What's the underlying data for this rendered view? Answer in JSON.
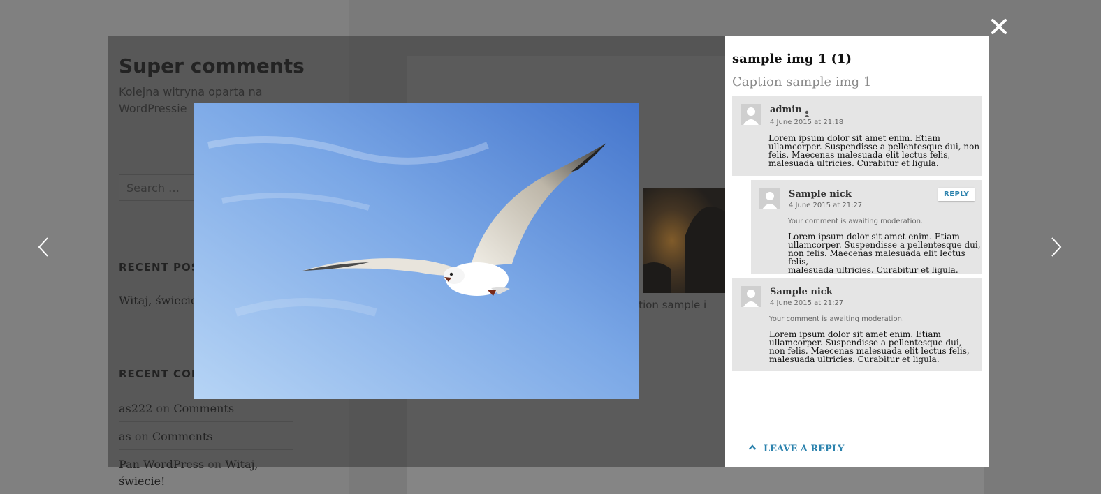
{
  "background_page": {
    "site_title": "Super comments",
    "tagline": "Kolejna witryna oparta na WordPressie",
    "search_placeholder": "Search …",
    "recent_posts_heading": "RECENT POSTS",
    "recent_posts": [
      "Witaj, świecie!"
    ],
    "recent_comments_heading": "RECENT COMMENTS",
    "recent_comments": [
      {
        "author": "as222",
        "on": "on",
        "post": "Comments"
      },
      {
        "author": "as",
        "on": "on",
        "post": "Comments"
      },
      {
        "author": "Pan WordPress",
        "on": "on",
        "post": "Witaj, świecie!"
      }
    ],
    "partial_caption": "Caption sample i"
  },
  "lightbox": {
    "close_icon": "close-icon",
    "prev_icon": "chevron-left-icon",
    "next_icon": "chevron-right-icon",
    "image_subject": "seagull in flight against blue sky"
  },
  "panel": {
    "title": "sample img 1 (1)",
    "caption": "Caption sample img 1",
    "comments": [
      {
        "author": "admin",
        "author_icon": "user-icon",
        "date": "4 June 2015 at 21:18",
        "text_lines": [
          "Lorem ipsum dolor sit amet enim. Etiam",
          "ullamcorper. Suspendisse a pellentesque dui, non",
          "felis. Maecenas malesuada elit lectus felis,",
          "malesuada ultricies. Curabitur et ligula."
        ]
      },
      {
        "author": "Sample nick",
        "date": "4 June 2015 at 21:27",
        "reply_label": "REPLY",
        "moderation": "Your comment is awaiting moderation.",
        "text_lines": [
          "Lorem ipsum dolor sit amet enim. Etiam",
          "ullamcorper. Suspendisse a pellentesque dui,",
          "non felis. Maecenas malesuada elit lectus felis,",
          "malesuada ultricies. Curabitur et ligula."
        ]
      },
      {
        "author": "Sample nick",
        "date": "4 June 2015 at 21:27",
        "moderation": "Your comment is awaiting moderation.",
        "text_lines": [
          "Lorem ipsum dolor sit amet enim. Etiam",
          "ullamcorper. Suspendisse a pellentesque dui,",
          "non felis. Maecenas malesuada elit lectus felis,",
          "malesuada ultricies. Curabitur et ligula."
        ]
      }
    ],
    "leave_reply_label": "LEAVE A REPLY",
    "leave_reply_icon": "chevron-up-icon"
  },
  "colors": {
    "accent": "#2b82ad",
    "panel_bg": "#ffffff",
    "comment_bg": "#e5e5e5",
    "overlay": "#7a7a7a"
  }
}
